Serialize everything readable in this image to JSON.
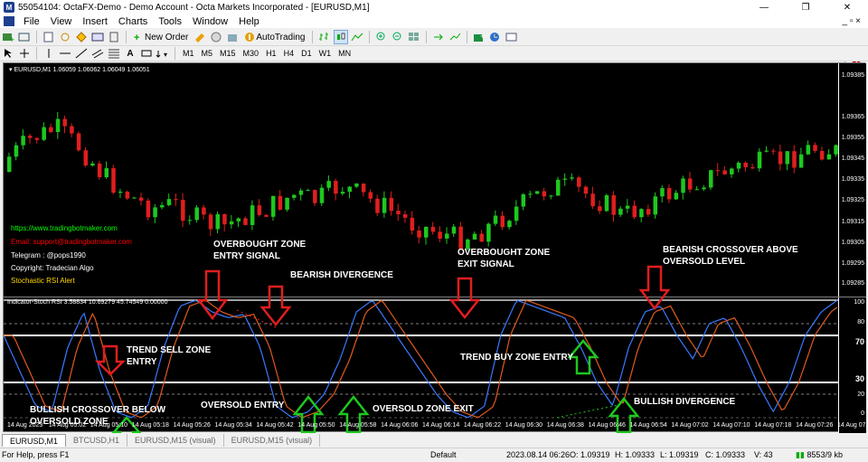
{
  "window": {
    "title": "55054104: OctaFX-Demo - Demo Account - Octa Markets Incorporated - [EURUSD,M1]",
    "controls": [
      "—",
      "❐",
      "✕"
    ]
  },
  "menu": [
    "File",
    "View",
    "Insert",
    "Charts",
    "Tools",
    "Window",
    "Help"
  ],
  "toolbar": {
    "new_order": "New Order",
    "autotrading": "AutoTrading",
    "timeframes": [
      "M1",
      "M5",
      "M15",
      "M30",
      "H1",
      "H4",
      "D1",
      "W1",
      "MN"
    ],
    "notification_count": "1"
  },
  "chart": {
    "symbol_info": "EURUSD,M1  1.06059 1.06062 1.06049 1.06051",
    "price_levels": [
      "1.09385",
      "1.09365",
      "1.09355",
      "1.09345",
      "1.09335",
      "1.09325",
      "1.09315",
      "1.09305",
      "1.09295",
      "1.09285"
    ],
    "side_texts": [
      {
        "text": "https://www.tradingbotmaker.com",
        "color": "#00ff00"
      },
      {
        "text": "Email: support@tradingbotmaker.com",
        "color": "#ff0000"
      },
      {
        "text": "Telegram : @pops1990",
        "color": "#ffffff"
      },
      {
        "text": "Copyright: Tradecian Algo",
        "color": "#ffffff"
      },
      {
        "text": "Stochastic RSI Alert",
        "color": "#ffd700"
      }
    ],
    "indicator_info": "Indicator-Stoch RSI 3.58834 10.69279 45.74549 0.00000",
    "indicator_levels": [
      "100",
      "80",
      "70",
      "30",
      "20",
      "0"
    ],
    "time_labels": [
      "14 Aug 2023",
      "14 Aug 05:02",
      "14 Aug 05:10",
      "14 Aug 05:18",
      "14 Aug 05:26",
      "14 Aug 05:34",
      "14 Aug 05:42",
      "14 Aug 05:50",
      "14 Aug 05:58",
      "14 Aug 06:06",
      "14 Aug 06:14",
      "14 Aug 06:22",
      "14 Aug 06:30",
      "14 Aug 06:38",
      "14 Aug 06:46",
      "14 Aug 06:54",
      "14 Aug 07:02",
      "14 Aug 07:10",
      "14 Aug 07:18",
      "14 Aug 07:26",
      "14 Aug 07:34"
    ],
    "annotations": {
      "overbought_entry": "OVERBOUGHT ZONE\nENTRY SIGNAL",
      "bearish_divergence": "BEARISH DIVERGENCE",
      "overbought_exit": "OVERBOUGHT ZONE\nEXIT SIGNAL",
      "bearish_crossover": "BEARISH CROSSOVER ABOVE\nOVERSOLD LEVEL",
      "trend_sell": "TREND SELL ZONE\nENTRY",
      "trend_buy": "TREND BUY ZONE ENTRY",
      "bullish_crossover": "BULLISH CROSSOVER BELOW\nOVERSOLD ZONE",
      "oversold_entry": "OVERSOLD ENTRY",
      "oversold_exit": "OVERSOLD ZONE EXIT",
      "bullish_divergence": "BULLISH DIVERGENCE"
    },
    "colors": {
      "bull": "#1ec81e",
      "bear": "#e01e1e",
      "main": "#3a78ff",
      "signal": "#e05a1e",
      "up_arrow": "#1ec81e",
      "down_arrow": "#e01e1e"
    }
  },
  "tabs": [
    "EURUSD,M1",
    "BTCUSD,H1",
    "EURUSD,M15 (visual)",
    "EURUSD,M15 (visual)"
  ],
  "status": {
    "help": "For Help, press F1",
    "profile": "Default",
    "time": "2023.08.14 06:26",
    "open": "O: 1.09319",
    "high": "H: 1.09333",
    "low": "L: 1.09319",
    "close": "C: 1.09333",
    "volume": "V: 43",
    "traffic": "8553/9 kb"
  }
}
